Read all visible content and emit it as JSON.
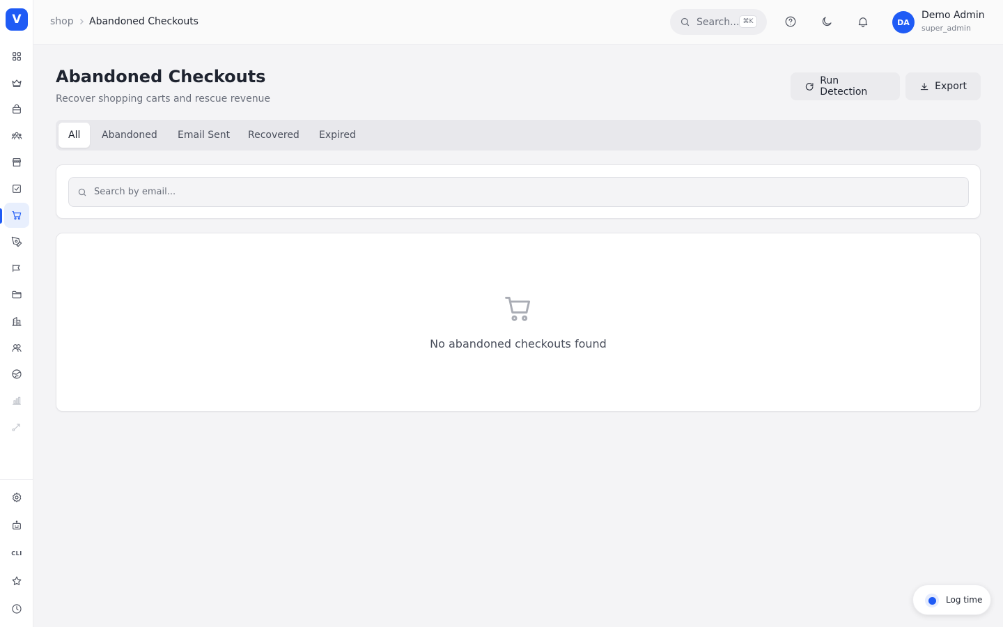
{
  "app": {
    "logo_letter": "V",
    "accent_color": "#1f5bf5"
  },
  "sidebar": {
    "items": [
      {
        "icon": "dashboard-grid-icon"
      },
      {
        "icon": "crown-icon"
      },
      {
        "icon": "shopping-bag-icon"
      },
      {
        "icon": "users-group-icon"
      },
      {
        "icon": "store-icon"
      },
      {
        "icon": "checkbox-icon"
      },
      {
        "icon": "shopping-cart-icon",
        "active": true
      },
      {
        "icon": "pen-tool-icon"
      },
      {
        "icon": "megaphone-icon"
      },
      {
        "icon": "folder-icon"
      },
      {
        "icon": "building-icon"
      },
      {
        "icon": "people-icon"
      },
      {
        "icon": "globe-icon"
      },
      {
        "icon": "bar-chart-icon",
        "disabled": true
      },
      {
        "icon": "route-icon",
        "disabled": true
      }
    ],
    "bottom": [
      {
        "icon": "gear-icon"
      },
      {
        "icon": "robot-icon"
      },
      {
        "label": "CLI"
      },
      {
        "icon": "star-icon"
      },
      {
        "icon": "clock-icon"
      }
    ]
  },
  "header": {
    "breadcrumb": {
      "root": "shop",
      "current": "Abandoned Checkouts"
    },
    "search": {
      "placeholder": "Search...",
      "shortcut": "⌘K"
    },
    "user": {
      "initials": "DA",
      "name": "Demo Admin",
      "role": "super_admin"
    }
  },
  "page": {
    "title": "Abandoned Checkouts",
    "subtitle": "Recover shopping carts and rescue revenue",
    "actions": {
      "run_detection": "Run Detection",
      "export": "Export"
    },
    "tabs": [
      {
        "label": "All",
        "active": true
      },
      {
        "label": "Abandoned"
      },
      {
        "label": "Email Sent"
      },
      {
        "label": "Recovered"
      },
      {
        "label": "Expired"
      }
    ],
    "email_search": {
      "placeholder": "Search by email...",
      "value": ""
    },
    "empty_state": {
      "message": "No abandoned checkouts found"
    }
  },
  "log_time": {
    "label": "Log time"
  }
}
